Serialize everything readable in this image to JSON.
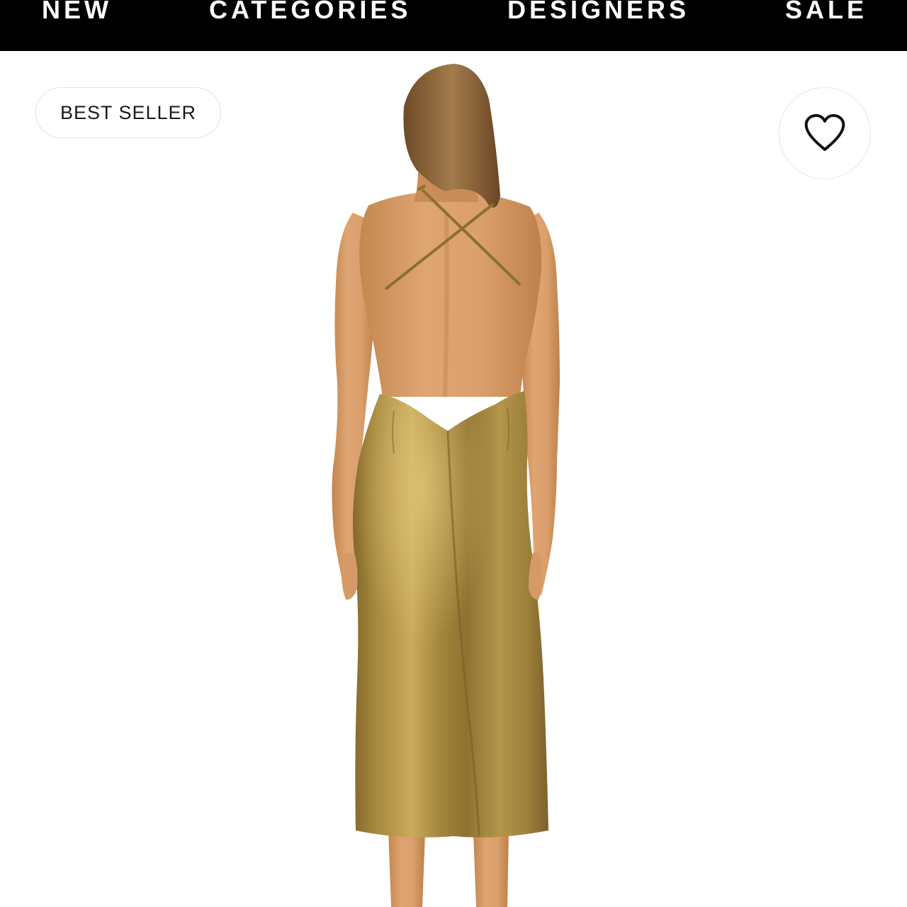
{
  "nav": {
    "items": [
      {
        "label": "NEW"
      },
      {
        "label": "CATEGORIES"
      },
      {
        "label": "DESIGNERS"
      },
      {
        "label": "SALE"
      }
    ]
  },
  "product": {
    "badge": "BEST SELLER",
    "image_subject": "back view of model in gold satin backless midi slip dress",
    "wishlist_icon": "heart-outline-icon"
  },
  "colors": {
    "nav_background": "#000000",
    "nav_text": "#ffffff",
    "dress_gold": "#a4873f",
    "skin": "#d59b69",
    "hair": "#8a6238"
  }
}
